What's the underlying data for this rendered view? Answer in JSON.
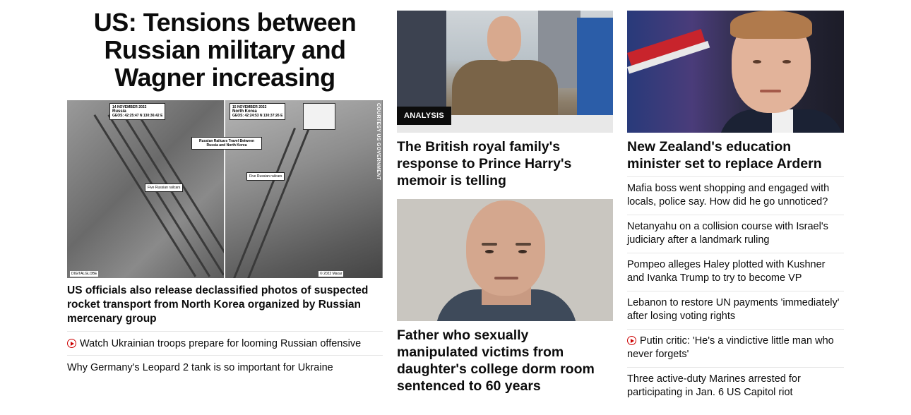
{
  "lead": {
    "headline": "US: Tensions between Russian military and Wagner increasing",
    "image": {
      "credit": "COURTESY US GOVERNMENT",
      "left_date": "14 NOVEMBER 2022",
      "left_title": "Russia",
      "left_geo": "GEOS: 42:25:47 N 130:36:42 E",
      "right_date": "15 NOVEMBER 2022",
      "right_title": "North Korea",
      "right_geo": "GEOS: 42:24:53 N 130:37:26 E",
      "center_caption": "Russian Railcars Travel Between Russia and North Korea",
      "left_marker": "Five Russian railcars",
      "right_marker": "Five Russian railcars",
      "footer_left": "DIGITALGLOBE",
      "footer_right": "© 2022 Maxar"
    },
    "sub_headline": "US officials also release declassified photos of suspected rocket transport from North Korea organized by Russian mercenary group",
    "links": [
      {
        "text": "Watch Ukrainian troops prepare for looming Russian offensive",
        "video": true
      },
      {
        "text": "Why Germany's Leopard 2 tank is so important for Ukraine",
        "video": false
      }
    ]
  },
  "middle": {
    "story1": {
      "badge": "ANALYSIS",
      "headline": "The British royal family's response to Prince Harry's memoir is telling"
    },
    "story2": {
      "headline": "Father who sexually manipulated victims from daughter's college dorm room sentenced to 60 years"
    }
  },
  "right": {
    "headline": "New Zealand's education minister set to replace Ardern",
    "items": [
      {
        "text": "Mafia boss went shopping and engaged with locals, police say. How did he go unnoticed?",
        "video": false
      },
      {
        "text": "Netanyahu on a collision course with Israel's judiciary after a landmark ruling",
        "video": false
      },
      {
        "text": "Pompeo alleges Haley plotted with Kushner and Ivanka Trump to try to become VP",
        "video": false
      },
      {
        "text": "Lebanon to restore UN payments 'immediately' after losing voting rights",
        "video": false
      },
      {
        "text": "Putin critic: 'He's a vindictive little man who never forgets'",
        "video": true
      },
      {
        "text": "Three active-duty Marines arrested for participating in Jan. 6 US Capitol riot",
        "video": false
      }
    ]
  },
  "colors": {
    "text": "#0c0c0c",
    "divider": "#e6e6e6",
    "video_red": "#cc0000",
    "badge_bg": "#0c0c0c"
  }
}
